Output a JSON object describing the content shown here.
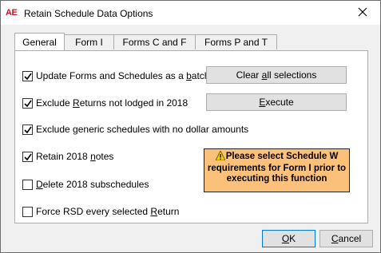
{
  "window": {
    "app_icon_text": "AE",
    "title": "Retain Schedule Data Options"
  },
  "tabs": [
    {
      "label": "General",
      "active": true
    },
    {
      "label": "Form I",
      "active": false
    },
    {
      "label": "Forms C and F",
      "active": false
    },
    {
      "label": "Forms P and T",
      "active": false
    }
  ],
  "options": {
    "update_batch": {
      "pre": "Update Forms and Schedules as a ",
      "accel": "b",
      "post": "atch",
      "checked": true
    },
    "exclude_not_lodged": {
      "pre": "Exclude ",
      "accel": "R",
      "post": "eturns not lodged in 2018",
      "checked": true
    },
    "exclude_generic": {
      "pre": "Exclude ",
      "accel": "g",
      "post": "eneric schedules with no dollar amounts",
      "checked": true
    },
    "retain_notes": {
      "pre": "Retain 2018 ",
      "accel": "n",
      "post": "otes",
      "checked": true
    },
    "delete_subschedules": {
      "pre": "",
      "accel": "D",
      "post": "elete 2018  subschedules",
      "checked": false
    },
    "force_rsd": {
      "pre": "Force RSD every selected ",
      "accel": "R",
      "post": "eturn",
      "checked": false
    }
  },
  "buttons": {
    "clear": {
      "pre": "Clear ",
      "accel": "a",
      "post": "ll selections"
    },
    "execute": {
      "pre": "",
      "accel": "E",
      "post": "xecute"
    },
    "ok": {
      "pre": "",
      "accel": "O",
      "post": "K"
    },
    "cancel": {
      "pre": "",
      "accel": "C",
      "post": "ancel"
    }
  },
  "notice": {
    "line1": "Please select  Schedule W",
    "line2": "requirements for Form I prior to",
    "line3": "executing this function",
    "icon": "warning-hand-icon",
    "bg_color": "#fbc07a"
  }
}
